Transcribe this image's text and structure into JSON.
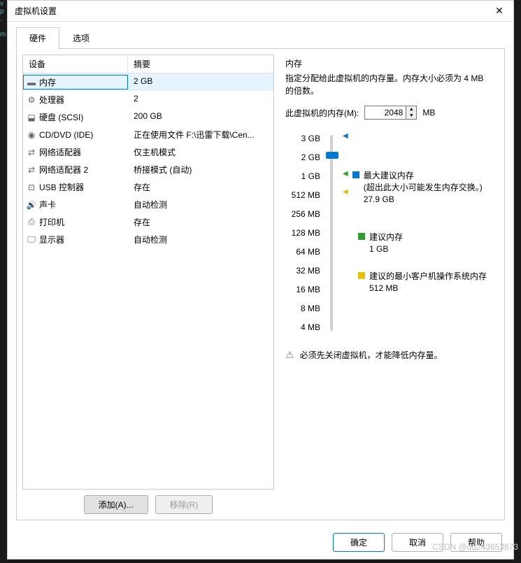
{
  "window": {
    "title": "虚拟机设置"
  },
  "tabs": [
    {
      "label": "硬件",
      "active": true
    },
    {
      "label": "选项",
      "active": false
    }
  ],
  "table": {
    "headers": {
      "device": "设备",
      "summary": "摘要"
    },
    "rows": [
      {
        "icon": "memory-icon",
        "device": "内存",
        "summary": "2 GB",
        "selected": true
      },
      {
        "icon": "cpu-icon",
        "device": "处理器",
        "summary": "2"
      },
      {
        "icon": "disk-icon",
        "device": "硬盘 (SCSI)",
        "summary": "200 GB"
      },
      {
        "icon": "cd-icon",
        "device": "CD/DVD (IDE)",
        "summary": "正在使用文件 F:\\迅雷下载\\Cen..."
      },
      {
        "icon": "network-icon",
        "device": "网络适配器",
        "summary": "仅主机模式"
      },
      {
        "icon": "network-icon",
        "device": "网络适配器 2",
        "summary": "桥接模式 (自动)"
      },
      {
        "icon": "usb-icon",
        "device": "USB 控制器",
        "summary": "存在"
      },
      {
        "icon": "sound-icon",
        "device": "声卡",
        "summary": "自动检测"
      },
      {
        "icon": "printer-icon",
        "device": "打印机",
        "summary": "存在"
      },
      {
        "icon": "display-icon",
        "device": "显示器",
        "summary": "自动检测"
      }
    ]
  },
  "left_buttons": {
    "add": "添加(A)...",
    "remove": "移除(R)"
  },
  "memory": {
    "title": "内存",
    "description": "指定分配给此虚拟机的内存量。内存大小必须为 4 MB 的倍数。",
    "input_label": "此虚拟机的内存(M):",
    "input_value": "2048",
    "unit": "MB",
    "slider_labels": [
      "3 GB",
      "2 GB",
      "1 GB",
      "512 MB",
      "256 MB",
      "128 MB",
      "64 MB",
      "32 MB",
      "16 MB",
      "8 MB",
      "4 MB"
    ],
    "markers": {
      "max": {
        "label": "最大建议内存",
        "note": "(超出此大小可能发生内存交换。)",
        "value": "27.9 GB"
      },
      "recommended": {
        "label": "建议内存",
        "value": "1 GB"
      },
      "min": {
        "label": "建议的最小客户机操作系统内存",
        "value": "512 MB"
      }
    },
    "warning": "必须先关闭虚拟机，才能降低内存量。"
  },
  "dialog_buttons": {
    "ok": "确定",
    "cancel": "取消",
    "help": "帮助"
  },
  "watermark": "CSDN @qq243653873"
}
